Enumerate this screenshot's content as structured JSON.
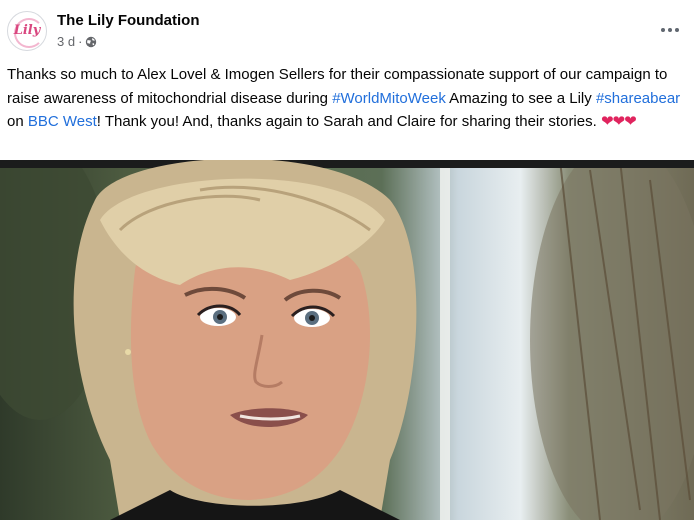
{
  "post": {
    "page_name": "The Lily Foundation",
    "avatar_text": "Lily",
    "timestamp": "3 d",
    "separator": "·",
    "icons": {
      "privacy": "globe-icon",
      "more": "more-options-icon"
    },
    "text": {
      "part1": "Thanks so much to Alex Lovel & Imogen Sellers for their compassionate support of our campaign to raise awareness of mitochondrial disease during ",
      "hashtag1": "#WorldMitoWeek",
      "part2": " Amazing to see a Lily ",
      "hashtag2": "#shareabear",
      "part3": " on ",
      "link_bbc": "BBC West",
      "part4": "! Thank you! And, thanks again to Sarah and Claire for sharing their stories. ",
      "hearts": "❤❤❤"
    },
    "colors": {
      "link": "#216fdb",
      "heart": "#e0245e",
      "meta": "#65676b"
    }
  }
}
